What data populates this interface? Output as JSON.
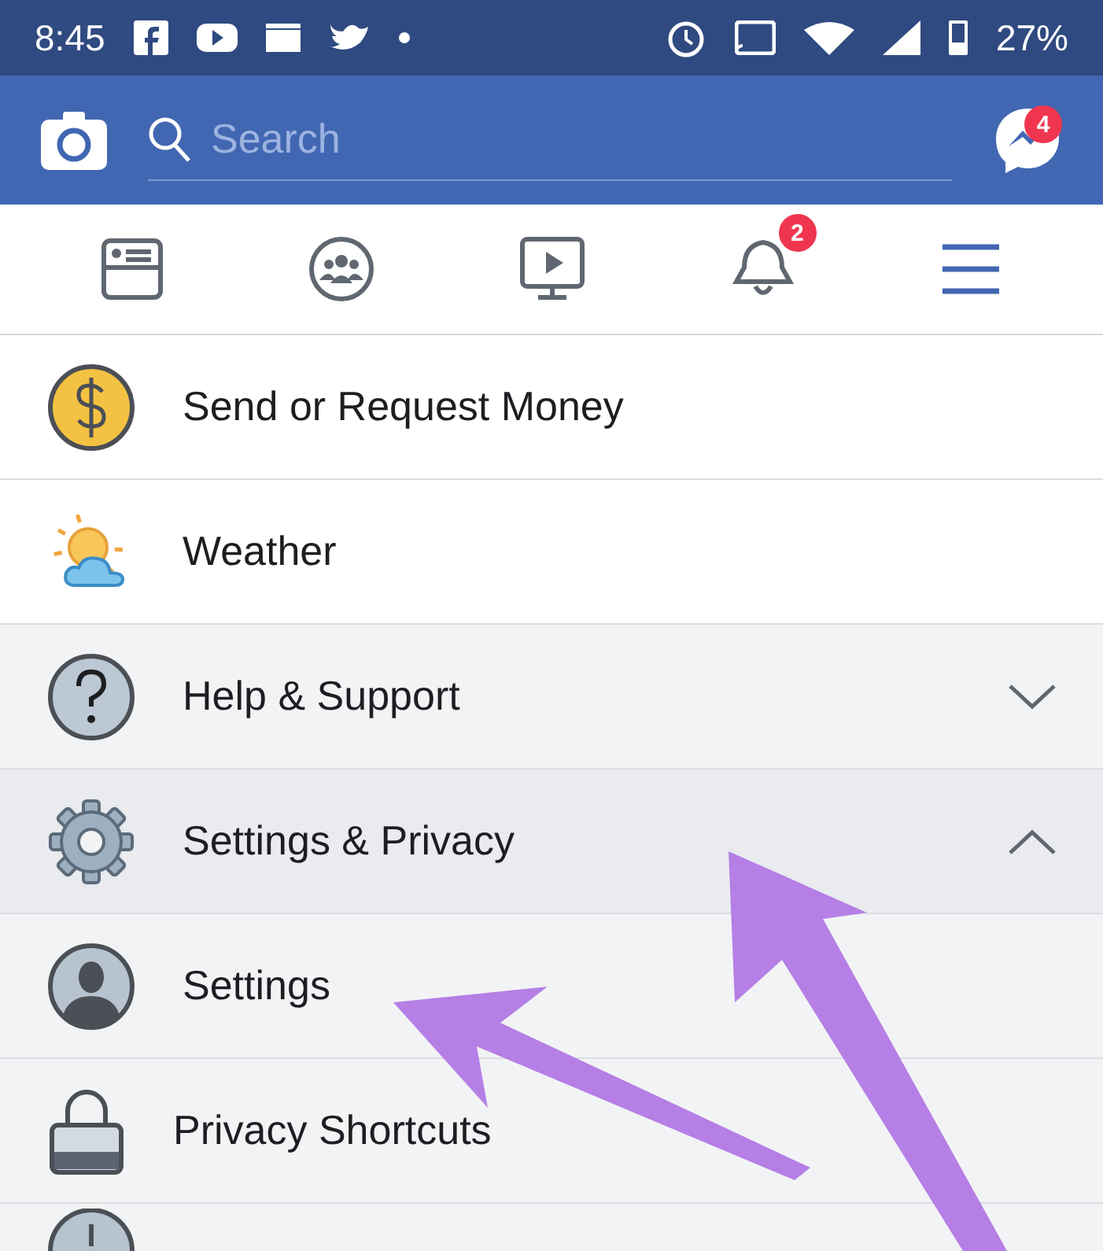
{
  "status_bar": {
    "time": "8:45",
    "battery": "27%"
  },
  "header": {
    "search": {
      "placeholder": "Search"
    },
    "messenger_badge": "4"
  },
  "nav_tabs": [
    {
      "selected": false
    },
    {
      "selected": false
    },
    {
      "selected": false
    },
    {
      "selected": false,
      "badge": "2"
    },
    {
      "selected": true
    }
  ],
  "menu_items": [
    {
      "kind": "item",
      "label": "Send or Request Money"
    },
    {
      "kind": "item",
      "label": "Weather"
    },
    {
      "kind": "section",
      "label": "Help & Support",
      "expanded": false
    },
    {
      "kind": "section",
      "label": "Settings & Privacy",
      "expanded": true
    },
    {
      "kind": "sub",
      "label": "Settings"
    },
    {
      "kind": "sub",
      "label": "Privacy Shortcuts"
    },
    {
      "kind": "sub"
    }
  ]
}
